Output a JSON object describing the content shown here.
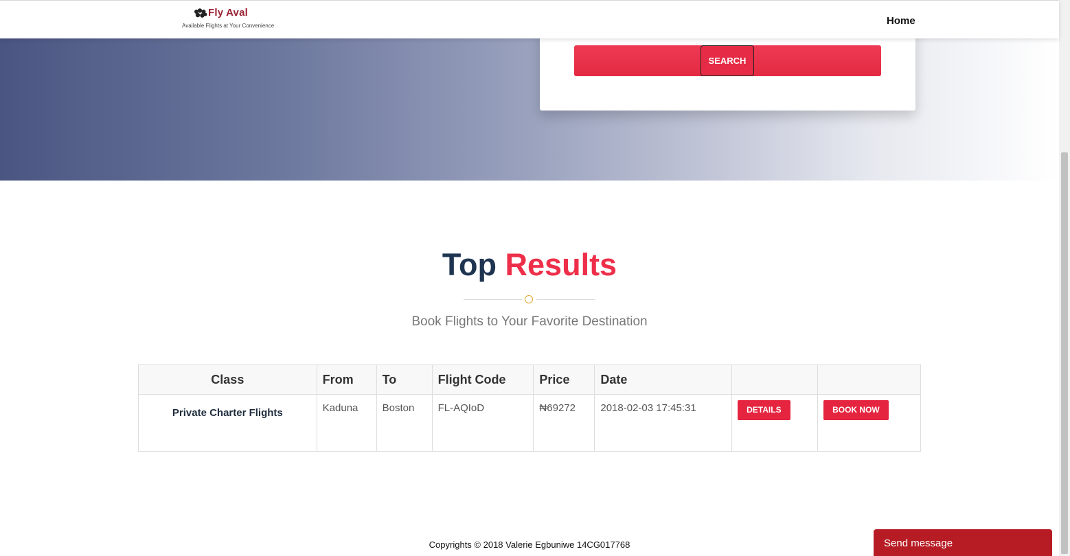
{
  "brand": {
    "name": "Fly Aval",
    "tagline": "Available Flights at Your Convenience"
  },
  "nav": {
    "home_label": "Home"
  },
  "search": {
    "button_label": "SEARCH"
  },
  "section": {
    "title_part1": "Top",
    "title_part2": "Results",
    "subtitle": "Book Flights to Your Favorite Destination"
  },
  "table": {
    "headers": {
      "class": "Class",
      "from": "From",
      "to": "To",
      "flight_code": "Flight Code",
      "price": "Price",
      "date": "Date",
      "details": "",
      "book": ""
    },
    "rows": [
      {
        "class": "Private Charter Flights",
        "from": "Kaduna",
        "to": "Boston",
        "flight_code": "FL-AQIoD",
        "price": "₦69272",
        "date": "2018-02-03 17:45:31",
        "details_label": "DETAILS",
        "book_label": "BOOK NOW"
      }
    ]
  },
  "footer": {
    "copyright": "Copyrights © 2018 Valerie Egbuniwe 14CG017768"
  },
  "chat": {
    "label": "Send message"
  },
  "colors": {
    "accent_red": "#ee2f4a",
    "dark_navy": "#1f3450",
    "chat_red": "#b71c25",
    "divider_gold": "#e1a72a"
  }
}
